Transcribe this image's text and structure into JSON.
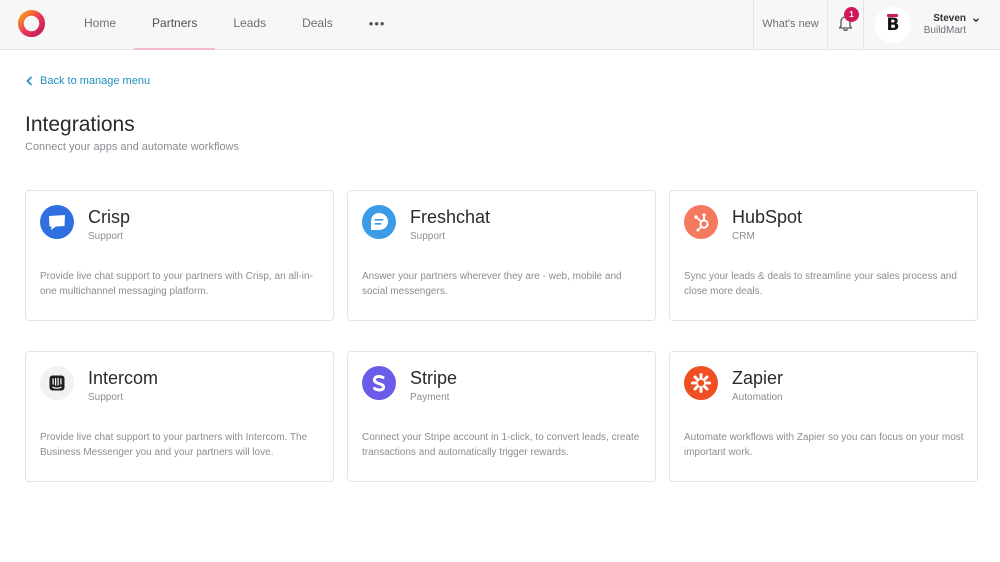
{
  "nav": {
    "items": [
      {
        "label": "Home"
      },
      {
        "label": "Partners"
      },
      {
        "label": "Leads"
      },
      {
        "label": "Deals"
      }
    ],
    "more_label": "•••",
    "whats_new": "What's new",
    "notification_count": "1",
    "user": {
      "name": "Steven",
      "org": "BuildMart",
      "avatar_letter": "B"
    }
  },
  "page": {
    "back_label": "Back to manage menu",
    "title": "Integrations",
    "subtitle": "Connect your apps and automate workflows"
  },
  "integrations": [
    {
      "name": "Crisp",
      "category": "Support",
      "description": "Provide live chat support to your partners with Crisp, an all-in-one multichannel messaging platform.",
      "icon": "crisp-icon",
      "color": "#2f6fe0"
    },
    {
      "name": "Freshchat",
      "category": "Support",
      "description": "Answer your partners wherever they are - web, mobile and social messengers.",
      "icon": "freshchat-icon",
      "color": "#3b9be6"
    },
    {
      "name": "HubSpot",
      "category": "CRM",
      "description": "Sync your leads & deals to streamline your sales process and close more deals.",
      "icon": "hubspot-icon",
      "color": "#f5795f"
    },
    {
      "name": "Intercom",
      "category": "Support",
      "description": "Provide live chat support to your partners with Intercom. The Business Messenger you and your partners will love.",
      "icon": "intercom-icon",
      "color": "#1f1f1f"
    },
    {
      "name": "Stripe",
      "category": "Payment",
      "description": "Connect your Stripe account in 1-click, to convert leads, create transactions and automatically trigger rewards.",
      "icon": "stripe-icon",
      "color": "#6a5ce8"
    },
    {
      "name": "Zapier",
      "category": "Automation",
      "description": "Automate workflows with Zapier so you can focus on your most important work.",
      "icon": "zapier-icon",
      "color": "#f04e23"
    }
  ],
  "colors": {
    "accent": "#d0185a",
    "link": "#1f8fbf",
    "active_tab_underline": "#f5b7d1"
  }
}
